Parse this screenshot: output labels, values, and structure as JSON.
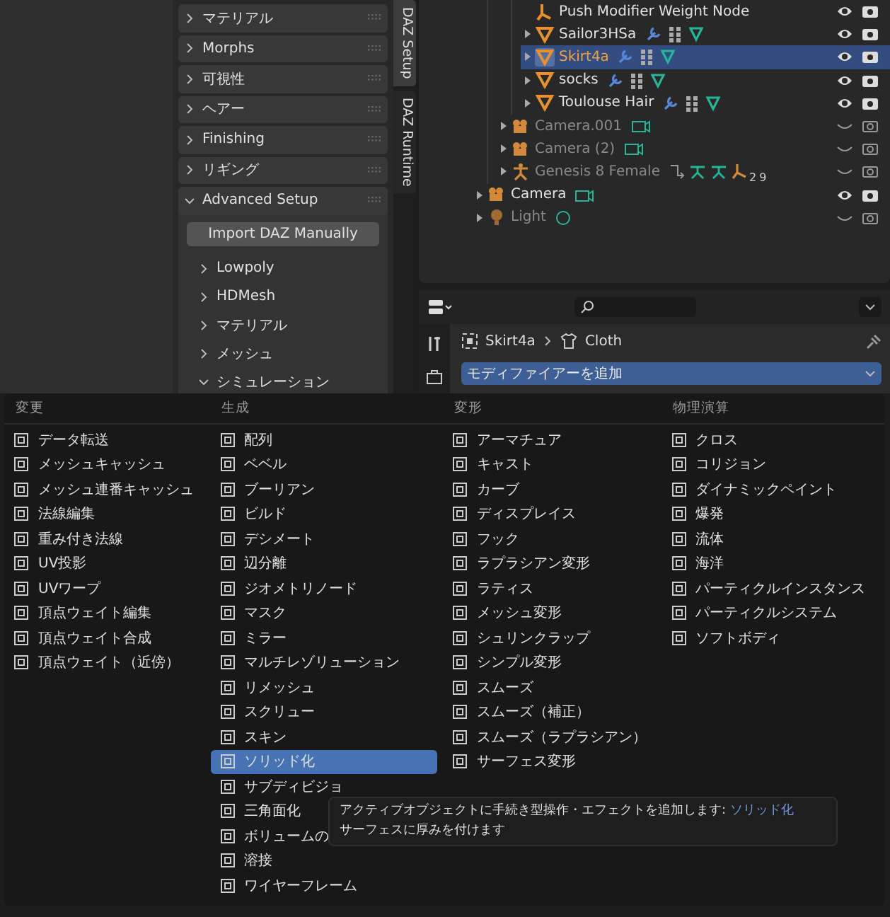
{
  "side_panel": {
    "panels": [
      {
        "label": "マテリアル",
        "expanded": false
      },
      {
        "label": "Morphs",
        "expanded": false
      },
      {
        "label": "可視性",
        "expanded": false
      },
      {
        "label": "ヘアー",
        "expanded": false
      },
      {
        "label": "Finishing",
        "expanded": false
      },
      {
        "label": "リギング",
        "expanded": false
      },
      {
        "label": "Advanced Setup",
        "expanded": true,
        "button": "Import DAZ Manually",
        "subpanels": [
          {
            "label": "Lowpoly",
            "expanded": false
          },
          {
            "label": "HDMesh",
            "expanded": false
          },
          {
            "label": "マテリアル",
            "expanded": false
          },
          {
            "label": "メッシュ",
            "expanded": false
          },
          {
            "label": "シミュレーション",
            "expanded": true
          }
        ]
      }
    ]
  },
  "side_tabs": [
    {
      "label": "DAZ Setup",
      "selected": true
    },
    {
      "label": "DAZ Runtime",
      "selected": false
    }
  ],
  "outliner": {
    "items": [
      {
        "children": [
          {
            "children": [
              {
                "label": "Push Modifier Weight Node",
                "kind": "node",
                "expandable": false,
                "selected": false,
                "visible": true
              },
              {
                "label": "Sailor3HSa",
                "kind": "mesh",
                "expandable": true,
                "selected": false,
                "visible": true
              },
              {
                "label": "Skirt4a",
                "kind": "mesh",
                "expandable": true,
                "selected": true,
                "visible": true
              },
              {
                "label": "socks",
                "kind": "mesh",
                "expandable": true,
                "selected": false,
                "visible": true
              },
              {
                "label": "Toulouse Hair",
                "kind": "mesh",
                "expandable": true,
                "selected": false,
                "visible": true
              }
            ]
          },
          {
            "label": "Camera.001",
            "kind": "camera",
            "expandable": true,
            "selected": false,
            "visible": false
          },
          {
            "label": "Camera (2)",
            "kind": "camera",
            "expandable": true,
            "selected": false,
            "visible": false
          },
          {
            "label": "Genesis 8 Female",
            "kind": "armature",
            "expandable": true,
            "selected": false,
            "visible": false,
            "counts": [
              "2",
              "9"
            ]
          }
        ]
      },
      {
        "label": "Camera",
        "kind": "camera",
        "expandable": true,
        "selected": false,
        "visible": true
      },
      {
        "label": "Light",
        "kind": "light",
        "expandable": true,
        "selected": false,
        "visible": false
      }
    ]
  },
  "properties": {
    "breadcrumb": [
      "Skirt4a",
      "Cloth"
    ],
    "add_modifier": "モディファイアーを追加"
  },
  "menu": {
    "columns": [
      {
        "title": "変更",
        "items": [
          {
            "label": "データ転送",
            "selected": false
          },
          {
            "label": "メッシュキャッシュ",
            "selected": false
          },
          {
            "label": "メッシュ連番キャッシュ",
            "selected": false
          },
          {
            "label": "法線編集",
            "selected": false
          },
          {
            "label": "重み付き法線",
            "selected": false
          },
          {
            "label": "UV投影",
            "selected": false
          },
          {
            "label": "UVワープ",
            "selected": false
          },
          {
            "label": "頂点ウェイト編集",
            "selected": false
          },
          {
            "label": "頂点ウェイト合成",
            "selected": false
          },
          {
            "label": "頂点ウェイト（近傍）",
            "selected": false
          }
        ]
      },
      {
        "title": "生成",
        "items": [
          {
            "label": "配列",
            "selected": false
          },
          {
            "label": "ベベル",
            "selected": false
          },
          {
            "label": "ブーリアン",
            "selected": false
          },
          {
            "label": "ビルド",
            "selected": false
          },
          {
            "label": "デシメート",
            "selected": false
          },
          {
            "label": "辺分離",
            "selected": false
          },
          {
            "label": "ジオメトリノード",
            "selected": false
          },
          {
            "label": "マスク",
            "selected": false
          },
          {
            "label": "ミラー",
            "selected": false
          },
          {
            "label": "マルチレゾリューション",
            "selected": false
          },
          {
            "label": "リメッシュ",
            "selected": false
          },
          {
            "label": "スクリュー",
            "selected": false
          },
          {
            "label": "スキン",
            "selected": false
          },
          {
            "label": "ソリッド化",
            "selected": true
          },
          {
            "label": "サブディビジョ",
            "selected": false
          },
          {
            "label": "三角面化",
            "selected": false
          },
          {
            "label": "ボリュームの",
            "selected": false
          },
          {
            "label": "溶接",
            "selected": false
          },
          {
            "label": "ワイヤーフレーム",
            "selected": false
          }
        ]
      },
      {
        "title": "変形",
        "items": [
          {
            "label": "アーマチュア",
            "selected": false
          },
          {
            "label": "キャスト",
            "selected": false
          },
          {
            "label": "カーブ",
            "selected": false
          },
          {
            "label": "ディスプレイス",
            "selected": false
          },
          {
            "label": "フック",
            "selected": false
          },
          {
            "label": "ラプラシアン変形",
            "selected": false
          },
          {
            "label": "ラティス",
            "selected": false
          },
          {
            "label": "メッシュ変形",
            "selected": false
          },
          {
            "label": "シュリンクラップ",
            "selected": false
          },
          {
            "label": "シンプル変形",
            "selected": false
          },
          {
            "label": "スムーズ",
            "selected": false
          },
          {
            "label": "スムーズ（補正）",
            "selected": false
          },
          {
            "label": "スムーズ（ラプラシアン）",
            "selected": false
          },
          {
            "label": "サーフェス変形",
            "selected": false
          }
        ]
      },
      {
        "title": "物理演算",
        "items": [
          {
            "label": "クロス",
            "selected": false
          },
          {
            "label": "コリジョン",
            "selected": false
          },
          {
            "label": "ダイナミックペイント",
            "selected": false
          },
          {
            "label": "爆発",
            "selected": false
          },
          {
            "label": "流体",
            "selected": false
          },
          {
            "label": "海洋",
            "selected": false
          },
          {
            "label": "パーティクルインスタンス",
            "selected": false
          },
          {
            "label": "パーティクルシステム",
            "selected": false
          },
          {
            "label": "ソフトボディ",
            "selected": false
          }
        ]
      }
    ]
  },
  "tooltip": {
    "description": "アクティブオブジェクトに手続き型操作・エフェクトを追加します:",
    "operator": "ソリッド化",
    "detail": "サーフェスに厚みを付けます"
  }
}
